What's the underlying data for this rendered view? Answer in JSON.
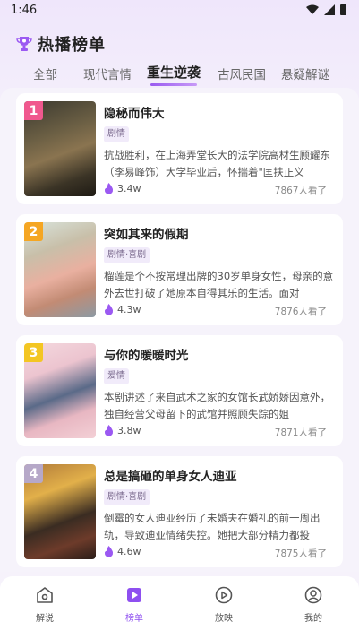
{
  "status": {
    "time": "1:46"
  },
  "header": {
    "title": "热播榜单",
    "icon": "trophy-icon"
  },
  "tabs": [
    {
      "label": "全部",
      "active": false
    },
    {
      "label": "现代言情",
      "active": false
    },
    {
      "label": "重生逆袭",
      "active": true
    },
    {
      "label": "古风民国",
      "active": false
    },
    {
      "label": "悬疑解谜",
      "active": false
    }
  ],
  "items": [
    {
      "rank": "1",
      "title": "隐秘而伟大",
      "genre": "剧情",
      "desc": "抗战胜利，在上海弄堂长大的法学院高材生顾耀东（李易峰饰）大学毕业后，怀揣着\"匡扶正义",
      "likes": "3.4w",
      "watched": "7867人看了",
      "rank_color": "#f0588e"
    },
    {
      "rank": "2",
      "title": "突如其来的假期",
      "genre": "剧情·喜剧",
      "desc": "榴莲是个不按常理出牌的30岁单身女性，母亲的意外去世打破了她原本自得其乐的生活。面对",
      "likes": "4.3w",
      "watched": "7876人看了",
      "rank_color": "#f5a623"
    },
    {
      "rank": "3",
      "title": "与你的暖暖时光",
      "genre": "爱情",
      "desc": "本剧讲述了来自武术之家的女馆长武娇娇因意外，独自经营父母留下的武馆并照顾失踪的姐",
      "likes": "3.8w",
      "watched": "7871人看了",
      "rank_color": "#f3c623"
    },
    {
      "rank": "4",
      "title": "总是搞砸的单身女人迪亚",
      "genre": "剧情·喜剧",
      "desc": "倒霉的女人迪亚经历了未婚夫在婚礼的前一周出轨，导致迪亚情绪失控。她把大部分精力都投",
      "likes": "4.6w",
      "watched": "7875人看了",
      "rank_color": "#b6a8c8"
    }
  ],
  "nav": [
    {
      "label": "解说",
      "icon": "home-icon",
      "active": false
    },
    {
      "label": "榜单",
      "icon": "ranking-icon",
      "active": true
    },
    {
      "label": "放映",
      "icon": "play-icon",
      "active": false
    },
    {
      "label": "我的",
      "icon": "profile-icon",
      "active": false
    }
  ],
  "colors": {
    "accent": "#8e4ff0",
    "background": "#f6f3fb"
  }
}
